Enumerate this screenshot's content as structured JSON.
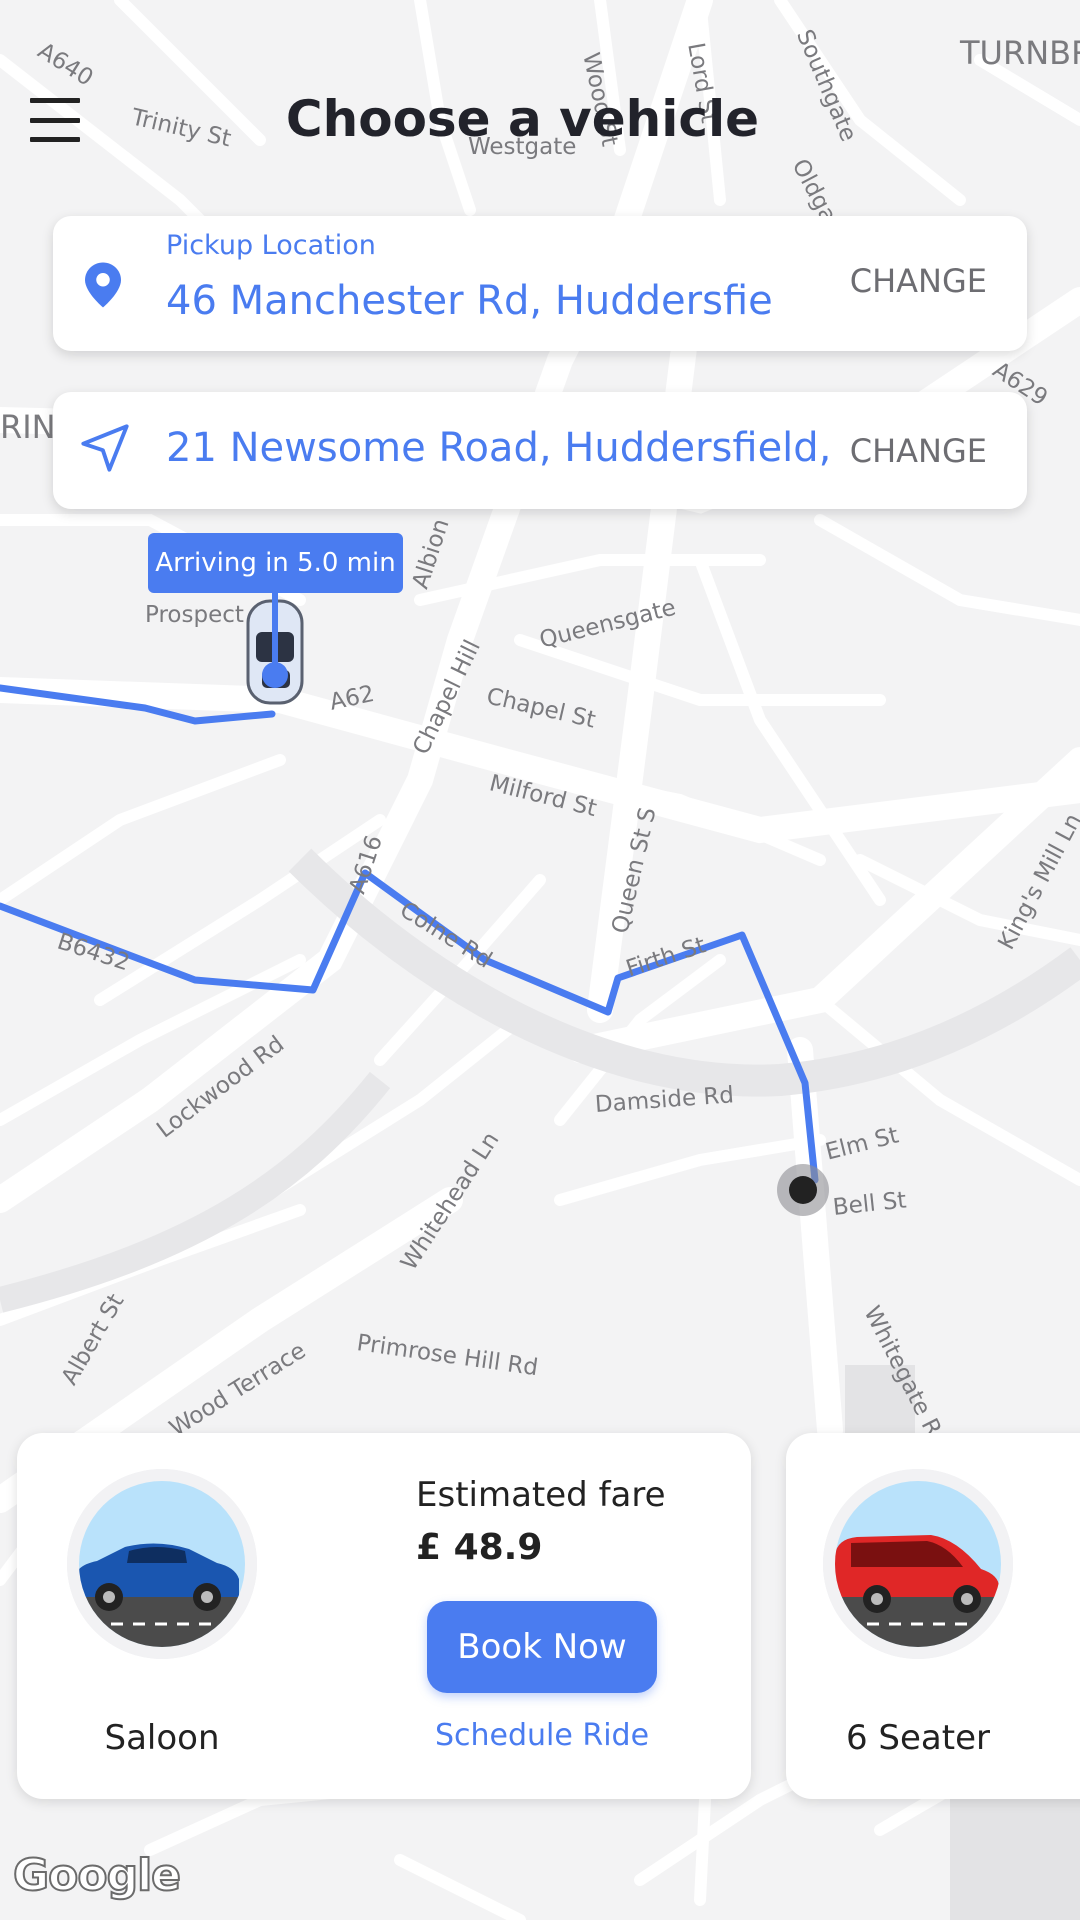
{
  "header": {
    "title": "Choose a vehicle"
  },
  "pickup": {
    "label": "Pickup Location",
    "address": "46 Manchester Rd, Huddersfie",
    "change_label": "CHANGE"
  },
  "destination": {
    "address": "21 Newsome Road, Huddersfield,",
    "change_label": "CHANGE"
  },
  "driver_eta": {
    "text": "Arriving in 5.0 min"
  },
  "map_labels": {
    "a640": "A640",
    "trinity": "Trinity St",
    "westgate": "Westgate",
    "wood": "Wood St",
    "lord": "Lord St",
    "southgate": "Southgate",
    "oldgate": "Oldgate",
    "turnbr": "TURNBR",
    "rin": "RIN",
    "a629": "A629",
    "albion": "Albion",
    "prospect": "Prospect",
    "a62": "A62",
    "queensgate": "Queensgate",
    "chapelhill": "Chapel Hill",
    "chapelst": "Chapel St",
    "milford": "Milford St",
    "queens": "Queen St S",
    "a616": "A616",
    "colne": "Colne Rd",
    "b6432": "B6432",
    "firth": "Firth St",
    "kingsmill": "King's Mill Ln",
    "lockwood": "Lockwood Rd",
    "damside": "Damside Rd",
    "elm": "Elm St",
    "bell": "Bell St",
    "whitehead": "Whitehead Ln",
    "albert": "Albert St",
    "primrose": "Primrose Hill Rd",
    "woodterrace": "Wood Terrace",
    "whitegate": "Whitegate Rd"
  },
  "vehicles": [
    {
      "name": "Saloon",
      "fare_label": "Estimated fare",
      "fare": "£ 48.9",
      "book_label": "Book Now",
      "schedule_label": "Schedule Ride",
      "car_color": "#1a56b0"
    },
    {
      "name": "6 Seater",
      "car_color": "#e02727"
    }
  ],
  "brand": {
    "google": "Google"
  },
  "colors": {
    "accent": "#4a7cf0",
    "route": "#4a7cf0"
  },
  "icons": {
    "menu": "menu-icon",
    "pickup": "map-pin-icon",
    "destination": "navigation-arrow-icon"
  }
}
